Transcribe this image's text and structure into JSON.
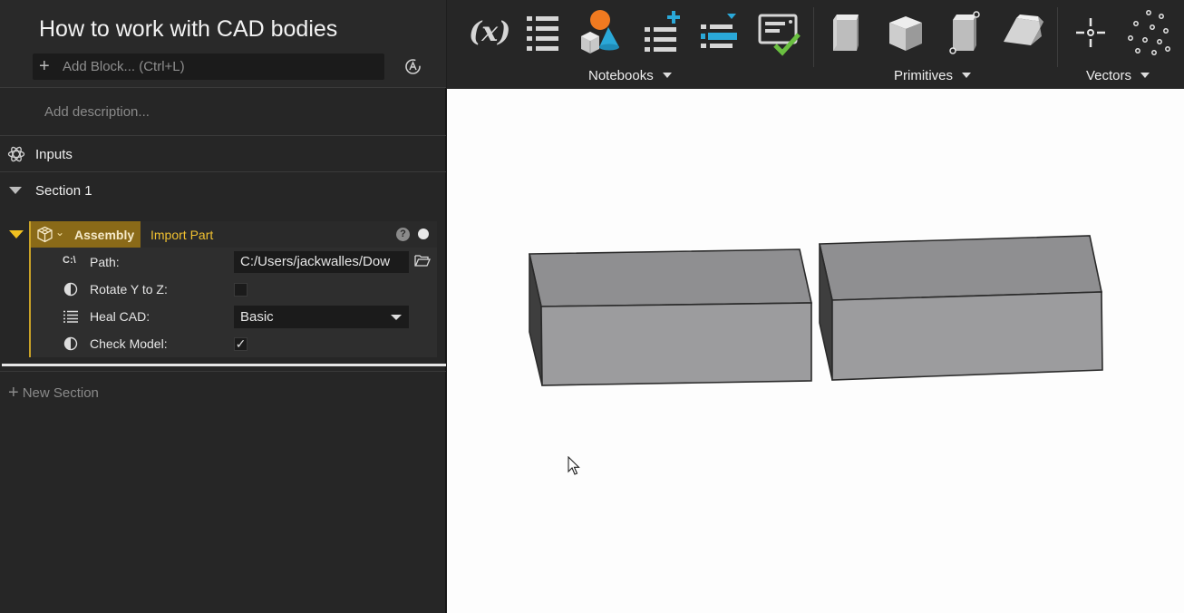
{
  "header": {
    "title": "How to work with CAD bodies",
    "add_block_placeholder": "Add Block... (Ctrl+L)",
    "description_placeholder": "Add description..."
  },
  "tree": {
    "inputs_label": "Inputs",
    "section_label": "Section 1",
    "new_section_label": "New Section"
  },
  "block": {
    "type_label": "Assembly",
    "name_label": "Import Part",
    "help_glyph": "?",
    "properties": {
      "path": {
        "icon_text": "C:\\",
        "label": "Path:",
        "value": "C:/Users/jackwalles/Dow"
      },
      "rotate": {
        "label": "Rotate Y to Z:",
        "checked": false
      },
      "heal": {
        "label": "Heal CAD:",
        "value": "Basic"
      },
      "check": {
        "label": "Check Model:",
        "checked": true,
        "check_glyph": "✓"
      }
    }
  },
  "toolbar": {
    "variables_glyph": "(x)",
    "groups": {
      "notebooks": "Notebooks",
      "primitives": "Primitives",
      "vectors": "Vectors"
    },
    "icons": [
      "variables-icon",
      "list-icon",
      "shapes-icon",
      "add-list-icon",
      "insert-list-icon",
      "check-report-icon",
      "box-icon",
      "cube-icon",
      "box-vertex-icon",
      "wedge-icon",
      "point-icon",
      "point-cloud-icon"
    ]
  },
  "colors": {
    "accent_gold": "#c9a227",
    "assembly_tab": "#8a6a18",
    "import_label": "#f0c030",
    "shapes_orange": "#f07a20",
    "shapes_cyan": "#2aa8d8",
    "check_green": "#6abf40",
    "panel_bg": "#262626",
    "viewport_bg": "#fdfdfd",
    "box_face": "#9a9a9c"
  }
}
